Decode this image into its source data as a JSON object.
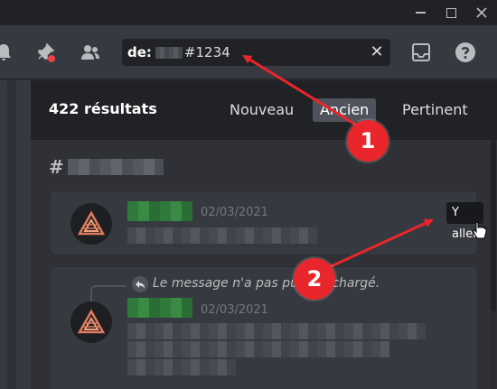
{
  "search": {
    "prefix": "de:",
    "suffix": "#1234",
    "clear_label": "✕"
  },
  "results": {
    "count_label": "422 résultats",
    "tabs": [
      {
        "label": "Nouveau"
      },
      {
        "label": "Ancien",
        "selected": true
      },
      {
        "label": "Pertinent"
      }
    ],
    "channel_prefix": "#",
    "messages": [
      {
        "timestamp": "02/03/2021",
        "goto_label": "Y aller"
      },
      {
        "timestamp": "02/03/2021",
        "reply_text": "Le message n'a pas pu être chargé."
      }
    ]
  },
  "annotations": [
    {
      "number": "1"
    },
    {
      "number": "2"
    }
  ],
  "colors": {
    "background": "#2f3136",
    "header": "#202225",
    "annotation": "#e8262b",
    "blurred_username": "#3a8a46"
  },
  "icons": [
    "bell-icon",
    "pin-icon",
    "members-icon",
    "inbox-icon",
    "help-icon",
    "reply-icon",
    "cursor-icon"
  ]
}
